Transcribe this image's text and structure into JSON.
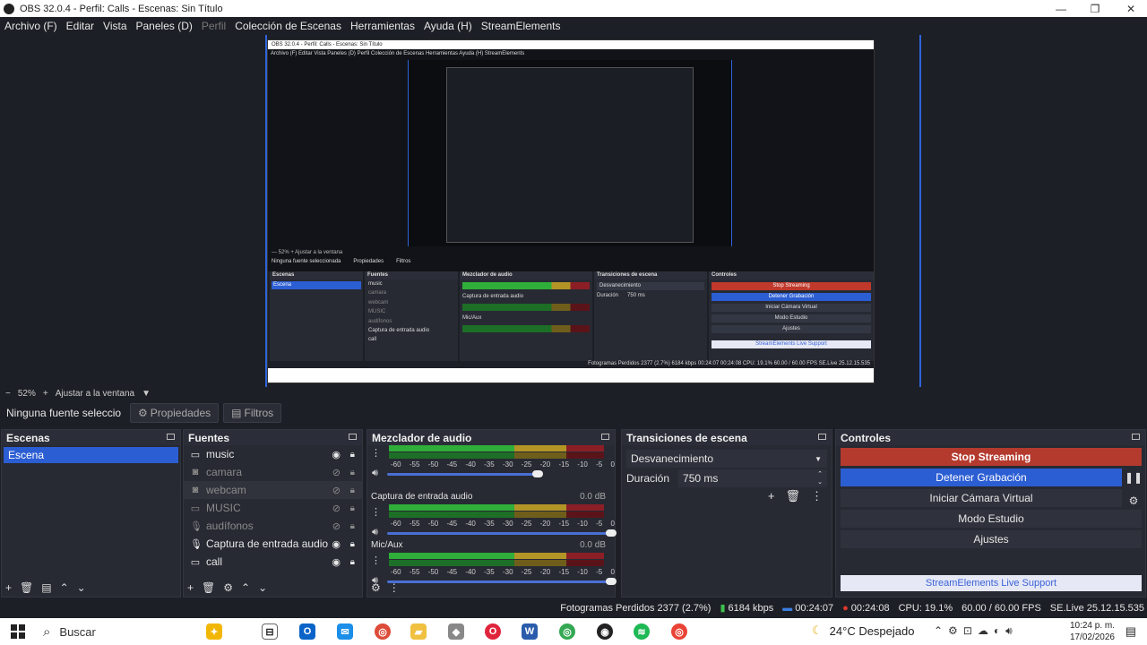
{
  "window": {
    "title": "OBS 32.0.4 - Perfil: Calls - Escenas: Sin Título",
    "minimize": "—",
    "maximize": "❐",
    "close": "✕"
  },
  "menu": {
    "items": [
      "Archivo (F)",
      "Editar",
      "Vista",
      "Paneles (D)",
      "Perfil",
      "Colección de Escenas",
      "Herramientas",
      "Ayuda (H)",
      "StreamElements"
    ]
  },
  "nested": {
    "title": "OBS 32.0.4 - Perfil: Calls - Escenas: Sin Título",
    "menu": "Archivo (F)   Editar   Vista   Paneles (D)   Perfil   Colección de Escenas   Herramientas   Ayuda (H)   StreamElements",
    "zoom": "— 52%  +  Ajustar a la ventana",
    "nosrc": "Ninguna fuente seleccionada",
    "props": "Propiedades",
    "filters": "Filtros",
    "scenes_h": "Escenas",
    "scene": "Escena",
    "sources_h": "Fuentes",
    "sources": [
      "music",
      "camara",
      "webcam",
      "MUSIC",
      "audífonos",
      "Captura de entrada audio",
      "call"
    ],
    "mixer_h": "Mezclador de audio",
    "mixer_ch1": "Captura de entrada audio",
    "mixer_ch2": "Mic/Aux",
    "trans_h": "Transiciones de escena",
    "trans": "Desvanecimiento",
    "dur_label": "Duración",
    "dur": "750 ms",
    "ctl_h": "Controles",
    "stop": "Stop Streaming",
    "rec": "Detener Grabación",
    "vcam": "Iniciar Cámara Virtual",
    "studio": "Modo Estudio",
    "settings": "Ajustes",
    "support": "StreamElements Live Support",
    "status": "Fotogramas Perdidos 2377 (2.7%)   6184 kbps   00:24:07   00:24:08   CPU: 19.1%   60.00 / 60.00 FPS   SE.Live 25.12.15.535"
  },
  "zoom": {
    "minus": "−",
    "value": "52%",
    "plus": "+",
    "fit": "Ajustar a la ventana"
  },
  "props": {
    "no_source": "Ninguna fuente selecciona",
    "properties": "Propiedades",
    "filters": "Filtros"
  },
  "scenes": {
    "header": "Escenas",
    "items": [
      "Escena"
    ]
  },
  "sources": {
    "header": "Fuentes",
    "items": [
      {
        "name": "music",
        "icon": "monitor-icon",
        "visible": true
      },
      {
        "name": "camara",
        "icon": "camera-icon",
        "visible": false
      },
      {
        "name": "webcam",
        "icon": "camera-icon",
        "visible": false
      },
      {
        "name": "MUSIC",
        "icon": "monitor-icon",
        "visible": false
      },
      {
        "name": "audífonos",
        "icon": "mic-icon",
        "visible": false
      },
      {
        "name": "Captura de entrada audio",
        "icon": "mic-icon",
        "visible": true
      },
      {
        "name": "call",
        "icon": "monitor-icon",
        "visible": true
      }
    ]
  },
  "mixer": {
    "header": "Mezclador de audio",
    "scale": [
      "-60",
      "-55",
      "-50",
      "-45",
      "-40",
      "-35",
      "-30",
      "-25",
      "-20",
      "-15",
      "-10",
      "-5",
      "0"
    ],
    "channels": [
      {
        "name": "",
        "db": ""
      },
      {
        "name": "Captura de entrada audio",
        "db": "0.0 dB"
      },
      {
        "name": "Mic/Aux",
        "db": "0.0 dB"
      }
    ]
  },
  "transitions": {
    "header": "Transiciones de escena",
    "selected": "Desvanecimiento",
    "duration_label": "Duración",
    "duration": "750 ms"
  },
  "controls": {
    "header": "Controles",
    "stop_streaming": "Stop Streaming",
    "stop_recording": "Detener Grabación",
    "virtual_cam": "Iniciar Cámara Virtual",
    "studio_mode": "Modo Estudio",
    "settings": "Ajustes",
    "support": "StreamElements Live Support"
  },
  "status": {
    "dropped": "Fotogramas Perdidos 2377 (2.7%)",
    "bitrate": "6184 kbps",
    "stream_time": "00:24:07",
    "rec_time": "00:24:08",
    "cpu": "CPU: 19.1%",
    "fps": "60.00 / 60.00 FPS",
    "se": "SE.Live 25.12.15.535"
  },
  "taskbar": {
    "search": "Buscar",
    "weather": "24°C  Despejado",
    "time": "10:24 p. m.",
    "date": "17/02/2026"
  }
}
